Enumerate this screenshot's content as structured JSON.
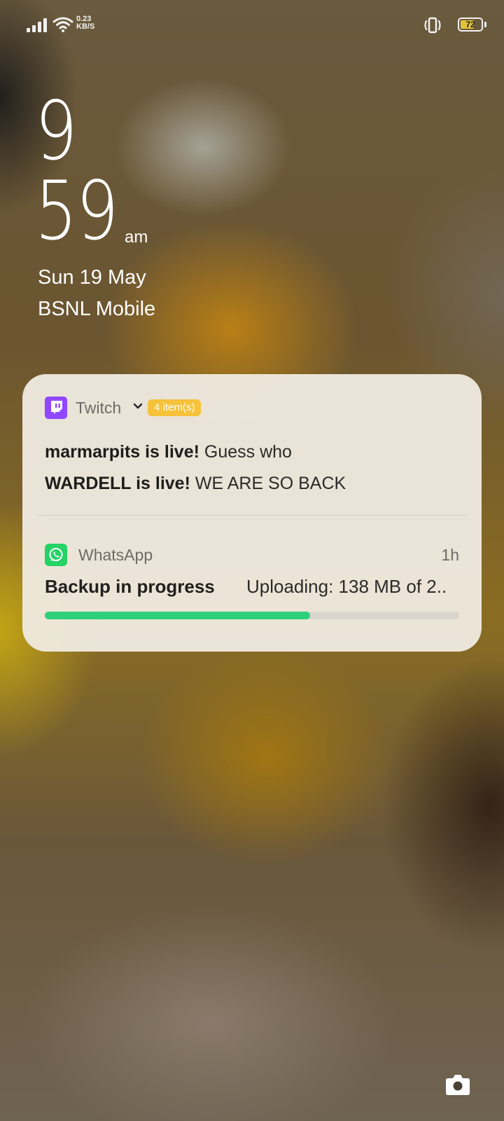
{
  "status_bar": {
    "net_speed_value": "0.23",
    "net_speed_unit": "KB/S",
    "battery_level": "72",
    "battery_fraction": 0.72,
    "icons": [
      "signal-icon",
      "wifi-icon",
      "vibrate-icon",
      "battery-icon"
    ]
  },
  "lockscreen": {
    "hour": "9",
    "minute": "59",
    "ampm": "am",
    "date": "Sun 19 May",
    "carrier": "BSNL Mobile"
  },
  "notifications": {
    "twitch": {
      "app_name": "Twitch",
      "count_badge": "4 item(s)",
      "lines": [
        {
          "title": "marmarpits is live!",
          "text": "Guess who"
        },
        {
          "title": "WARDELL is live!",
          "text": "WE ARE SO BACK"
        }
      ]
    },
    "whatsapp": {
      "app_name": "WhatsApp",
      "time": "1h",
      "title": "Backup in progress",
      "status": "Uploading: 138 MB of 2..",
      "progress": 0.64
    }
  },
  "colors": {
    "twitch_brand": "#9146ff",
    "whatsapp_brand": "#25d366",
    "badge": "#f5c23a",
    "progress": "#2fd07a"
  },
  "shortcuts": {
    "camera_icon": "camera-icon"
  }
}
